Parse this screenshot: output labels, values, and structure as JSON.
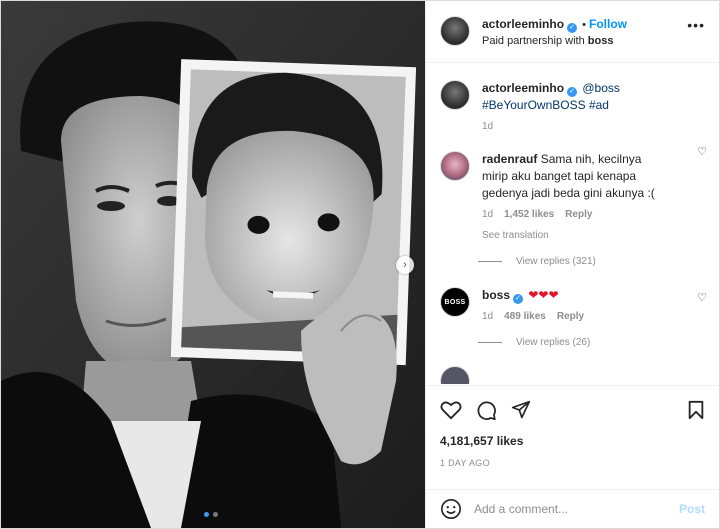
{
  "post": {
    "author": "actorleeminho",
    "follow_label": "Follow",
    "partnership_prefix": "Paid partnership with",
    "partner": "boss",
    "more_label": "•••",
    "caption": {
      "user": "actorleeminho",
      "mention": "@boss",
      "hashtags": "#BeYourOwnBOSS #ad",
      "time": "1d"
    },
    "comments": [
      {
        "user": "radenrauf",
        "text_line1": "Sama nih, kecilnya",
        "text_line2": "mirip aku banget tapi kenapa",
        "text_line3": "gedenya jadi beda gini akunya :(",
        "time": "1d",
        "likes": "1,452 likes",
        "reply": "Reply",
        "see_translation": "See translation",
        "view_replies": "View replies (321)"
      },
      {
        "user": "boss",
        "avatar_text": "BOSS",
        "text": "❤❤❤",
        "time": "1d",
        "likes": "489 likes",
        "reply": "Reply",
        "view_replies": "View replies (26)"
      },
      {
        "user": "",
        "text": ""
      }
    ],
    "likes_count": "4,181,657 likes",
    "posted": "1 DAY AGO",
    "add_comment_placeholder": "Add a comment...",
    "post_label": "Post",
    "carousel": {
      "slides": 2,
      "active_index": 0
    }
  },
  "colors": {
    "accent": "#0095f6",
    "verified": "#3897f0",
    "heart_red": "#e0152b",
    "muted": "#8e8e8e"
  }
}
